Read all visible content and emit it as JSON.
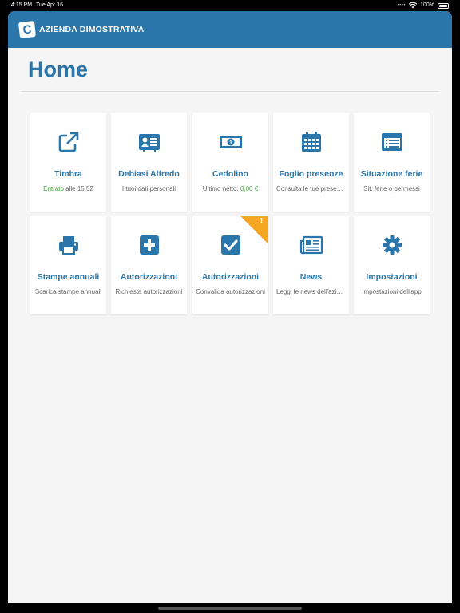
{
  "status_bar": {
    "time": "4:15 PM",
    "date": "Tue Apr 16",
    "battery": "100%"
  },
  "header": {
    "logo_letter": "C",
    "brand": "AZIENDA DIMOSTRATIVA"
  },
  "page": {
    "title": "Home"
  },
  "colors": {
    "primary": "#2a76ab",
    "badge": "#f5a623",
    "green": "#3ea33a"
  },
  "tiles": [
    {
      "title": "Timbra",
      "sub_green": "Entrato",
      "sub": " alle 15:52",
      "icon": "external-link-icon"
    },
    {
      "title": "Debiasi Alfredo",
      "sub": "I tuoi dati personali",
      "icon": "id-card-icon"
    },
    {
      "title": "Cedolino",
      "sub": "Ultimo netto: ",
      "sub_green": "0,00 €",
      "icon": "money-bill-icon"
    },
    {
      "title": "Foglio presenze",
      "sub": "Consulta le tue presenze",
      "icon": "calendar-icon"
    },
    {
      "title": "Situazione ferie",
      "sub": "Sit. ferie o permessi",
      "icon": "list-window-icon"
    },
    {
      "title": "Stampe annuali",
      "sub": "Scarica stampe annuali",
      "icon": "printer-icon"
    },
    {
      "title": "Autorizzazioni",
      "sub": "Richiesta autorizzazioni",
      "icon": "plus-square-icon"
    },
    {
      "title": "Autorizzazioni",
      "sub": "Convalida autorizzazioni",
      "icon": "check-square-icon",
      "badge": "1"
    },
    {
      "title": "News",
      "sub": "Leggi le news dell'azienda",
      "icon": "newspaper-icon"
    },
    {
      "title": "Impostazioni",
      "sub": "Impostazioni dell'app",
      "icon": "gear-icon"
    }
  ]
}
